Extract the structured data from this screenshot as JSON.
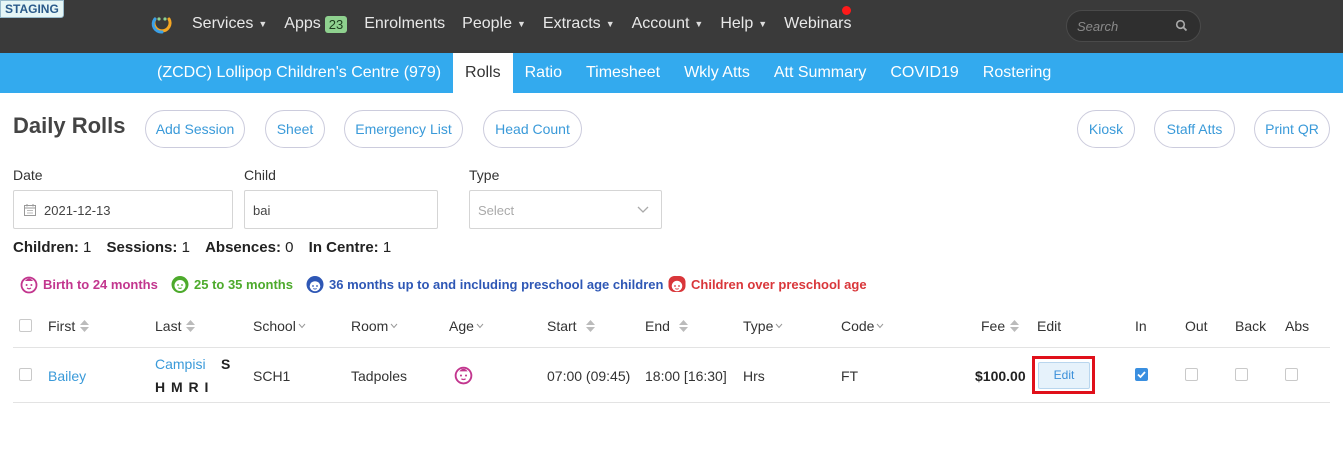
{
  "env_badge": "STAGING",
  "nav": {
    "items": [
      {
        "label": "Services",
        "caret": true
      },
      {
        "label": "Apps",
        "badge": "23"
      },
      {
        "label": "Enrolments"
      },
      {
        "label": "People",
        "caret": true
      },
      {
        "label": "Extracts",
        "caret": true
      },
      {
        "label": "Account",
        "caret": true
      },
      {
        "label": "Help",
        "caret": true
      },
      {
        "label": "Webinars"
      }
    ],
    "search_placeholder": "Search"
  },
  "subnav": {
    "centre": "(ZCDC) Lollipop Children's Centre (979)",
    "tabs": [
      "Rolls",
      "Ratio",
      "Timesheet",
      "Wkly Atts",
      "Att Summary",
      "COVID19",
      "Rostering"
    ],
    "active": "Rolls"
  },
  "page": {
    "title": "Daily Rolls",
    "actions_left": [
      "Add Session",
      "Sheet",
      "Emergency List",
      "Head Count"
    ],
    "actions_right": [
      "Kiosk",
      "Staff Atts",
      "Print QR"
    ]
  },
  "filters": {
    "date_label": "Date",
    "date_value": "2021-12-13",
    "child_label": "Child",
    "child_value": "bai",
    "type_label": "Type",
    "type_placeholder": "Select"
  },
  "stats": {
    "children_label": "Children:",
    "children": "1",
    "sessions_label": "Sessions:",
    "sessions": "1",
    "absences_label": "Absences:",
    "absences": "0",
    "in_centre_label": "In Centre:",
    "in_centre": "1"
  },
  "legend": [
    {
      "label": "Birth to 24 months",
      "color": "#c2368e"
    },
    {
      "label": "25 to 35 months",
      "color": "#4daa2c"
    },
    {
      "label": "36 months up to and including preschool age children",
      "color": "#2e57b5"
    },
    {
      "label": "Children over preschool age",
      "color": "#d9363a"
    }
  ],
  "table": {
    "headers": [
      "First",
      "Last",
      "School",
      "Room",
      "Age",
      "Start",
      "End",
      "Type",
      "Code",
      "Fee",
      "Edit",
      "In",
      "Out",
      "Back",
      "Abs"
    ],
    "rows": [
      {
        "first": "Bailey",
        "last": "Campisi",
        "last_flag": "S",
        "flags": "H M R I",
        "school": "SCH1",
        "room": "Tadpoles",
        "start": "07:00 (09:45)",
        "end": "18:00 [16:30]",
        "type": "Hrs",
        "code": "FT",
        "fee": "$100.00",
        "edit": "Edit",
        "in": true,
        "out": false,
        "back": false,
        "abs": false
      }
    ]
  }
}
